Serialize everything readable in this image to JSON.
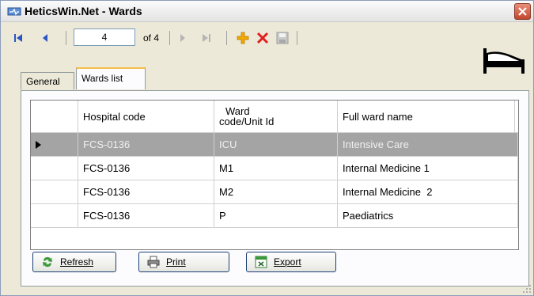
{
  "window": {
    "title": "HeticsWin.Net - Wards"
  },
  "navigator": {
    "position": "4",
    "of_label": "of 4"
  },
  "tabs": [
    {
      "label": "General"
    },
    {
      "label": "Wards list"
    }
  ],
  "grid": {
    "columns": [
      "Hospital code",
      "Ward code/Unit Id",
      "Full ward name"
    ],
    "column_header_lines": {
      "ward": [
        "Ward",
        "code/Unit Id"
      ]
    },
    "rows": [
      [
        "FCS-0136",
        "ICU",
        "Intensive Care"
      ],
      [
        "FCS-0136",
        "M1",
        "Internal Medicine 1"
      ],
      [
        "FCS-0136",
        "M2",
        "Internal Medicine  2"
      ],
      [
        "FCS-0136",
        "P",
        "Paediatrics"
      ]
    ],
    "selected_row": 0
  },
  "buttons": {
    "refresh": "Refresh",
    "print": "Print",
    "export": "Export"
  },
  "colors": {
    "title_close": "#c2452c",
    "selected_row": "#a4a4a4",
    "tab_highlight": "#f6bd4a",
    "add_icon": "#f2a900",
    "delete_icon": "#e02020"
  }
}
